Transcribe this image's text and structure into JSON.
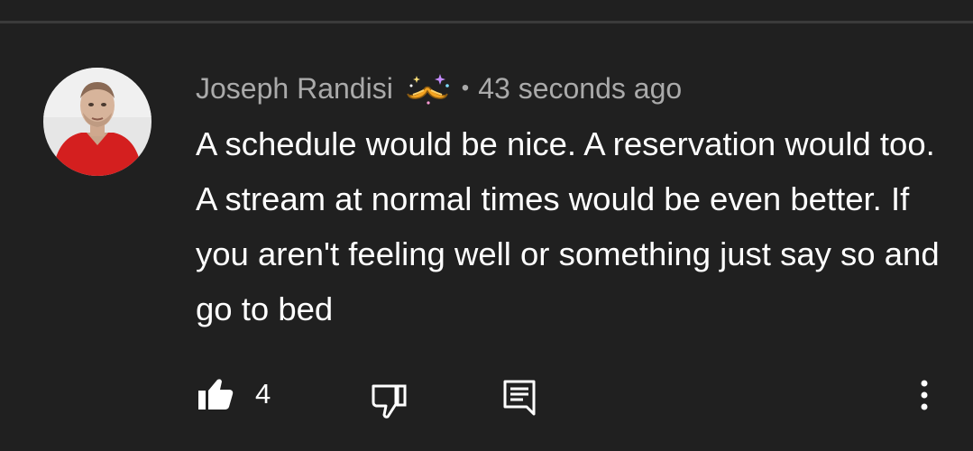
{
  "comment": {
    "author": "Joseph Randisi",
    "badge_icon": "mustache-sparkle-badge-icon",
    "separator": "•",
    "timestamp": "43 seconds ago",
    "text": "A schedule would be nice. A reservation would too. A stream at normal times would be even better. If you aren't feeling well or something just say so and go to bed",
    "like_count": "4"
  },
  "icons": {
    "like": "thumbs-up-icon",
    "dislike": "thumbs-down-icon",
    "reply": "reply-comment-icon",
    "more": "more-vertical-icon"
  },
  "colors": {
    "background": "#202020",
    "text_primary": "#ffffff",
    "text_secondary": "#aaaaaa",
    "divider": "#3a3a3a"
  }
}
